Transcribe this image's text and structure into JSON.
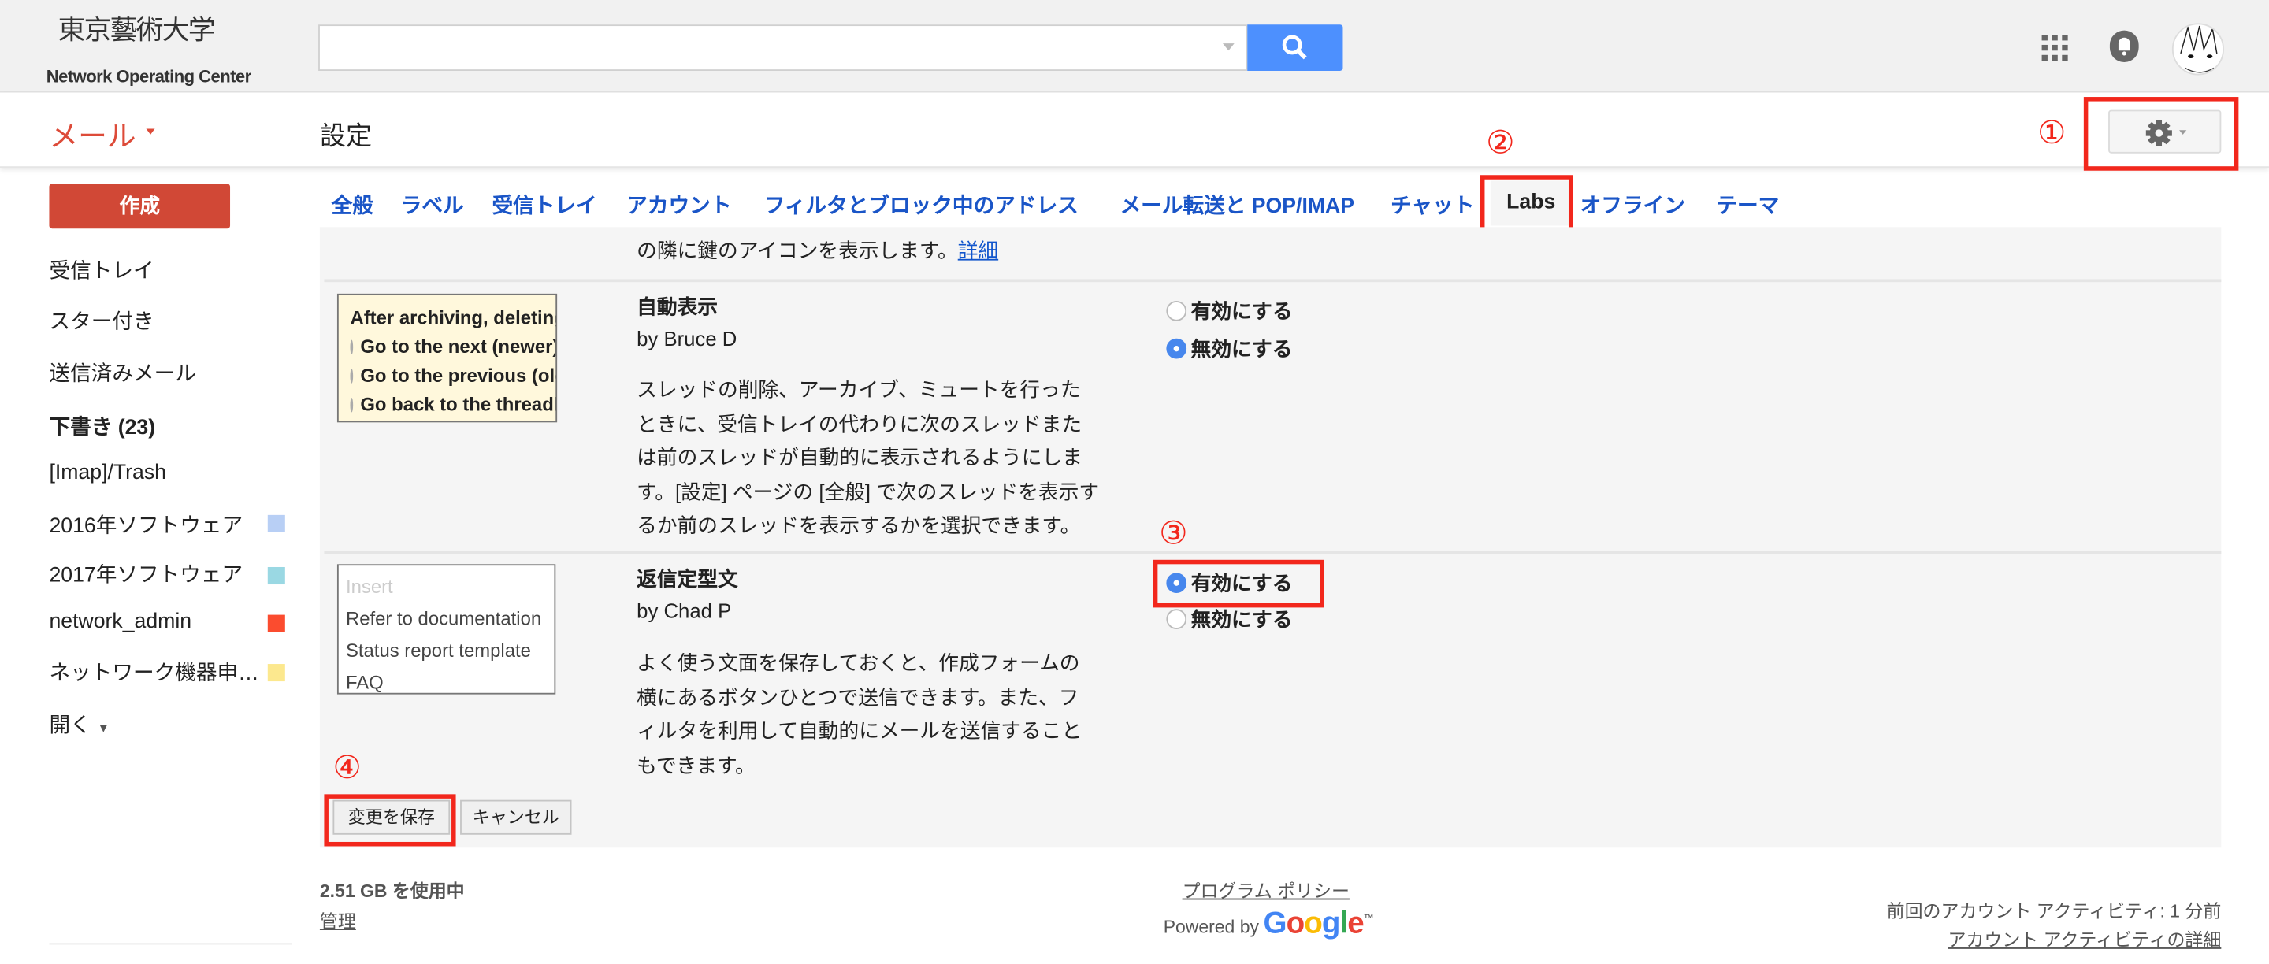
{
  "header": {
    "logo_text_jp": "東京藝術大学",
    "logo_text_en": "Network Operating Center",
    "search": {
      "value": "",
      "placeholder": ""
    },
    "icons": [
      "search-icon",
      "apps-icon",
      "bell-icon",
      "avatar"
    ]
  },
  "toolbar": {
    "app_label": "メール",
    "page_title": "設定"
  },
  "annotations": {
    "one": "①",
    "two": "②",
    "three": "③",
    "four": "④"
  },
  "sidebar": {
    "compose_label": "作成",
    "items": [
      {
        "label": "受信トレイ"
      },
      {
        "label": "スター付き"
      },
      {
        "label": "送信済みメール"
      },
      {
        "label": "下書き (23)"
      },
      {
        "label": "[Imap]/Trash"
      },
      {
        "label": "2016年ソフトウェア",
        "color": "#b8cff5"
      },
      {
        "label": "2017年ソフトウェア",
        "color": "#9ad8e3"
      },
      {
        "label": "network_admin",
        "color": "#fb4c2f"
      },
      {
        "label": "ネットワーク機器申…",
        "color": "#fce88e"
      }
    ],
    "more_label": "開く"
  },
  "tabs": [
    "全般",
    "ラベル",
    "受信トレイ",
    "アカウント",
    "フィルタとブロック中のアドレス",
    "メール転送と POP/IMAP",
    "チャット",
    "Labs",
    "オフライン",
    "テーマ"
  ],
  "labs": {
    "partial_text": "の隣に鍵のアイコンを表示します。",
    "partial_link": "詳細",
    "features": [
      {
        "title": "自動表示",
        "author": "by Bruce D",
        "description": [
          "スレッドの削除、アーカイブ、ミュートを行った",
          "ときに、受信トレイの代わりに次のスレッドまた",
          "は前のスレッドが自動的に表示されるようにしま",
          "す。[設定] ページの [全般] で次のスレッドを表示す",
          "るか前のスレッドを表示するかを選択できます。"
        ],
        "preview": [
          "After archiving, deleting, m",
          "Go to the next (newer)",
          "Go to the previous (older)",
          "Go back to the threadlist"
        ],
        "enable_label": "有効にする",
        "disable_label": "無効にする",
        "enabled": false
      },
      {
        "title": "返信定型文",
        "author": "by Chad P",
        "description": [
          "よく使う文面を保存しておくと、作成フォームの",
          "横にあるボタンひとつで送信できます。また、フ",
          "ィルタを利用して自動的にメールを送信すること",
          "もできます。"
        ],
        "preview": [
          "Insert",
          "Refer to documentation",
          "Status report template",
          "FAQ"
        ],
        "enable_label": "有効にする",
        "disable_label": "無効にする",
        "enabled": true
      }
    ],
    "save_label": "変更を保存",
    "cancel_label": "キャンセル"
  },
  "footer": {
    "storage": "2.51 GB を使用中",
    "manage": "管理",
    "policy": "プログラム ポリシー",
    "powered_by": "Powered by",
    "google": "Google",
    "last_activity": "前回のアカウント アクティビティ: 1 分前",
    "activity_details": "アカウント アクティビティの詳細"
  },
  "colors": {
    "accent": "#4d90fe",
    "compose": "#d14836",
    "annotation": "#f2271c",
    "tab_link": "#1a55c7"
  }
}
